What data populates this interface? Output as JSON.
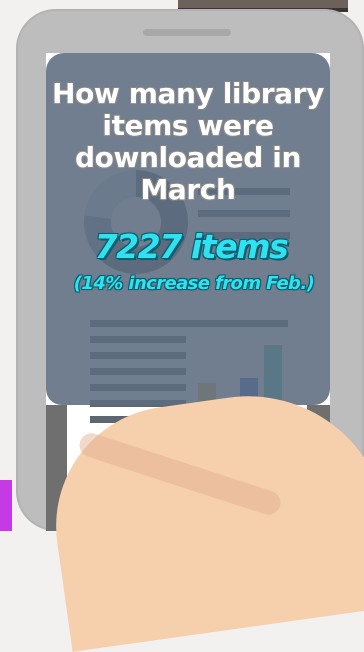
{
  "headline": "How many library items were downloaded in March",
  "stat": {
    "value_text": "7227 items",
    "change_text": "(14% increase from Feb.)"
  },
  "colors": {
    "overlay": "#5c6c80",
    "accent_cyan": "#30e2ef",
    "hand": "#f6cfad",
    "bar_yellow": "#f2b84b",
    "bar_orange": "#f47a52",
    "bar_blue": "#2d6fd2",
    "bar_teal": "#42c7b3"
  }
}
